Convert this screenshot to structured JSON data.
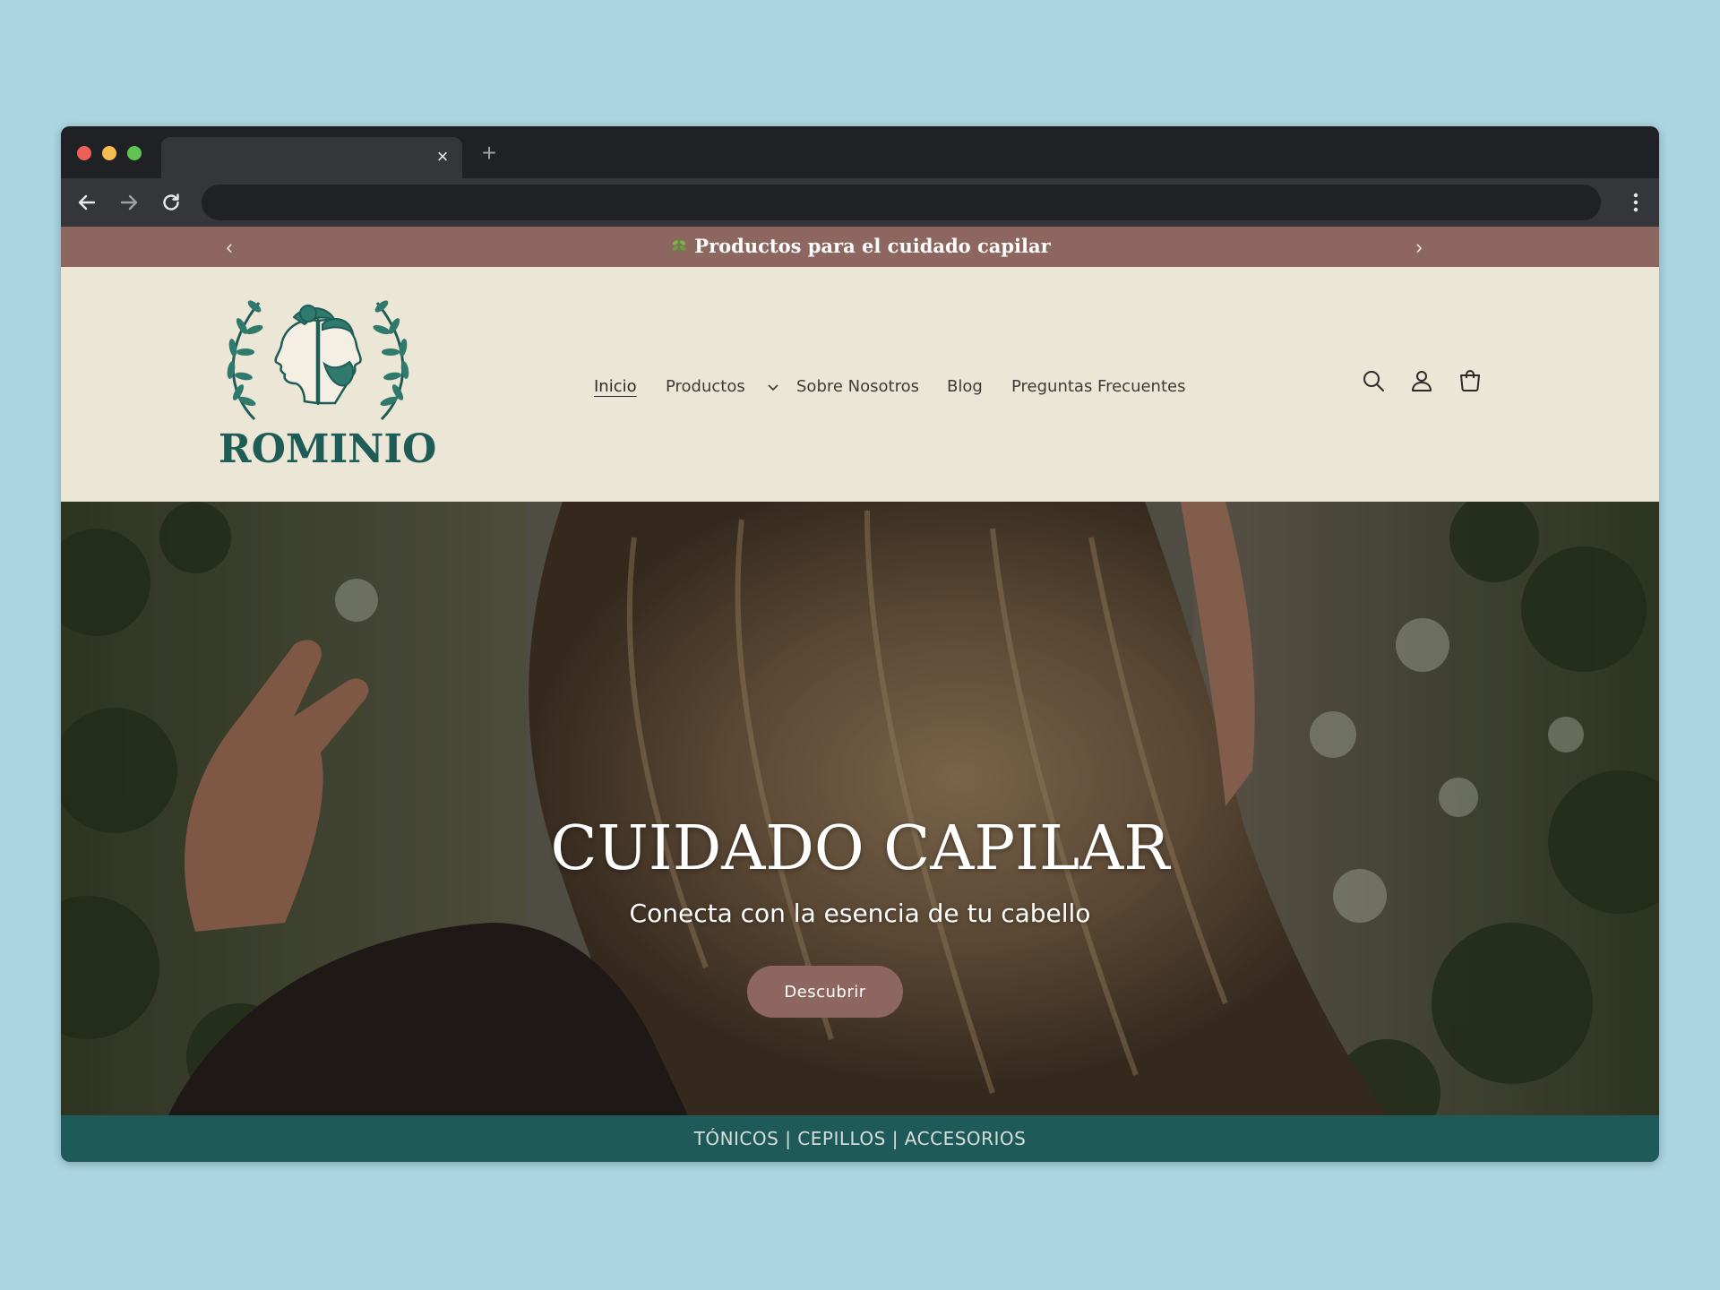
{
  "browser": {
    "tab_title": "",
    "tab_close": "×",
    "new_tab": "+",
    "address": ""
  },
  "announcement": {
    "text": "Productos para el cuidado capilar",
    "prev": "‹",
    "next": "›",
    "background": "#8d675f"
  },
  "header": {
    "logo_text": "ROMINIO",
    "nav": [
      {
        "label": "Inicio",
        "active": true
      },
      {
        "label": "Productos",
        "has_dropdown": true
      },
      {
        "label": "Sobre Nosotros"
      },
      {
        "label": "Blog"
      },
      {
        "label": "Preguntas Frecuentes"
      }
    ],
    "icons": [
      "search-icon",
      "account-icon",
      "cart-icon"
    ]
  },
  "hero": {
    "title": "CUIDADO CAPILAR",
    "subtitle": "Conecta con la esencia de tu cabello",
    "button": "Descubrir"
  },
  "footer_strip": {
    "text": "TÓNICOS | CEPILLOS | ACCESORIOS",
    "background": "#1e5a59"
  },
  "colors": {
    "brand_green": "#1e5c58",
    "header_bg": "#ebe6d5",
    "accent_mauve": "#8d675f"
  }
}
